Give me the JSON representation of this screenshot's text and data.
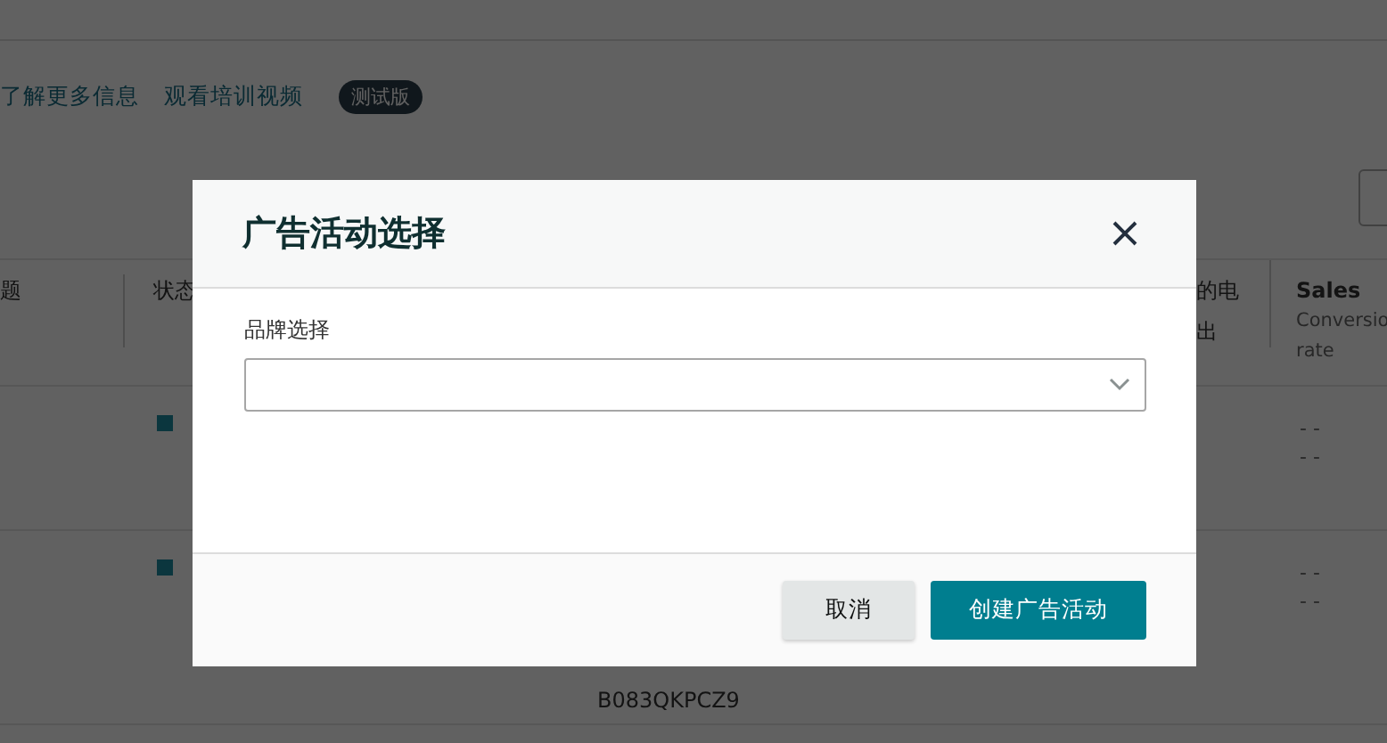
{
  "background_page": {
    "links": [
      {
        "label": "了解更多信息"
      },
      {
        "label": "观看培训视频"
      }
    ],
    "badge": "测试版",
    "table": {
      "columns": [
        {
          "title": "题"
        },
        {
          "title": "状态"
        },
        {},
        {
          "title": "的电",
          "subtitle": [
            "出"
          ]
        },
        {
          "title": "Sales",
          "subtitle": [
            "Conversio",
            "rate"
          ]
        }
      ],
      "rows": [
        {
          "metrics": [
            "- -",
            "- -"
          ]
        },
        {
          "asin": "B083QKPCZ9",
          "metrics": [
            "- -",
            "- -"
          ]
        }
      ]
    }
  },
  "dialog": {
    "title": "广告活动选择",
    "field": {
      "label": "品牌选择"
    },
    "buttons": [
      {
        "label": "取消",
        "kind": "secondary"
      },
      {
        "label": "创建广告活动",
        "kind": "primary"
      }
    ]
  }
}
